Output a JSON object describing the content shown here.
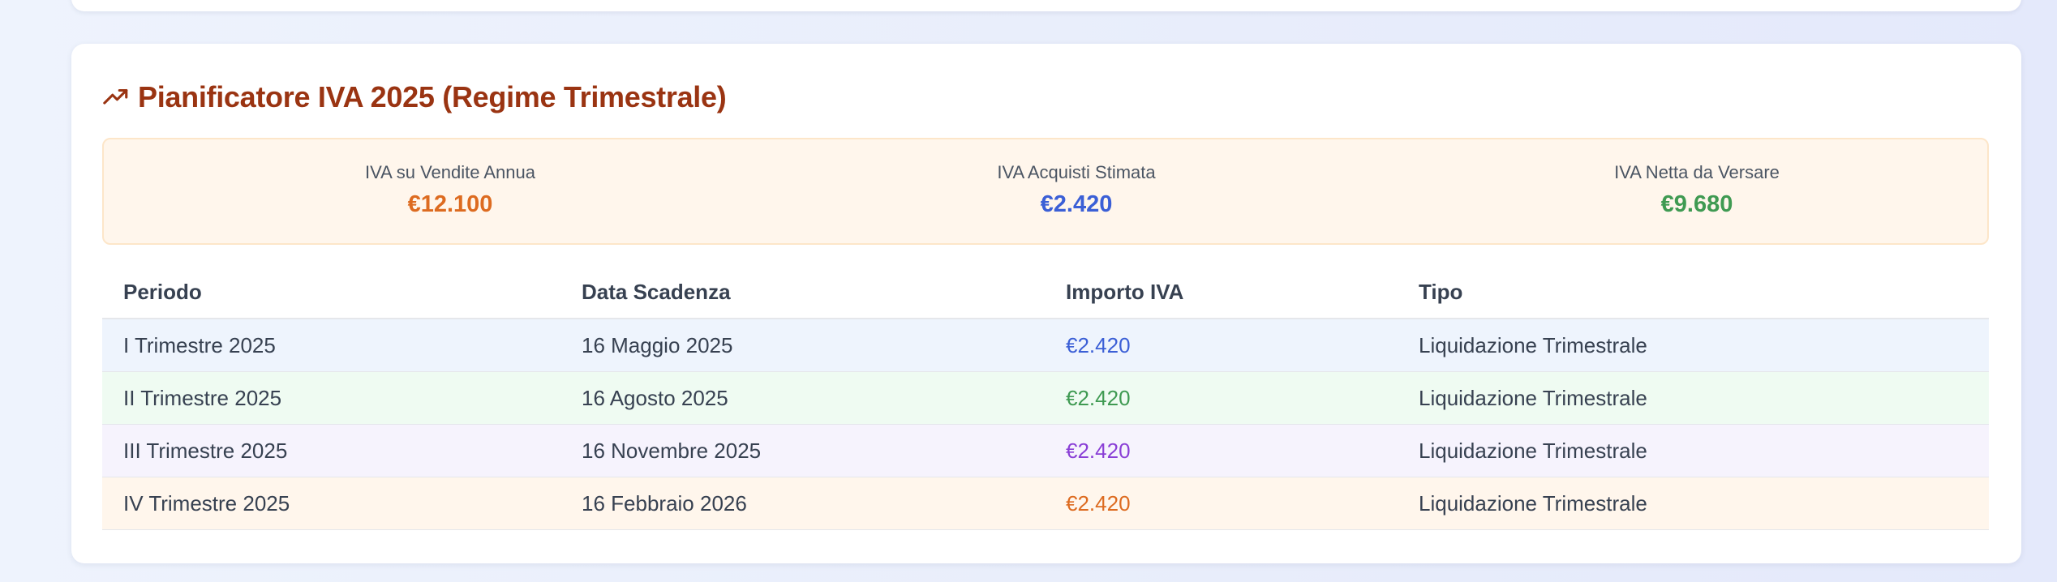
{
  "planner": {
    "title": "Pianificatore IVA 2025 (Regime Trimestrale)",
    "icon": "trending-up-icon",
    "title_color": "#9a3412",
    "summary": [
      {
        "label": "IVA su Vendite Annua",
        "value": "€12.100",
        "color": "#dd6b20"
      },
      {
        "label": "IVA Acquisti Stimata",
        "value": "€2.420",
        "color": "#3b5fd6"
      },
      {
        "label": "IVA Netta da Versare",
        "value": "€9.680",
        "color": "#3f9a52"
      }
    ],
    "table": {
      "headers": [
        "Periodo",
        "Data Scadenza",
        "Importo IVA",
        "Tipo"
      ],
      "rows": [
        {
          "periodo": "I Trimestre 2025",
          "scadenza": "16 Maggio 2025",
          "importo": "€2.420",
          "tipo": "Liquidazione Trimestrale",
          "color": "#3b5fd6"
        },
        {
          "periodo": "II Trimestre 2025",
          "scadenza": "16 Agosto 2025",
          "importo": "€2.420",
          "tipo": "Liquidazione Trimestrale",
          "color": "#3f9a52"
        },
        {
          "periodo": "III Trimestre 2025",
          "scadenza": "16 Novembre 2025",
          "importo": "€2.420",
          "tipo": "Liquidazione Trimestrale",
          "color": "#8a3fd6"
        },
        {
          "periodo": "IV Trimestre 2025",
          "scadenza": "16 Febbraio 2026",
          "importo": "€2.420",
          "tipo": "Liquidazione Trimestrale",
          "color": "#dd6b20"
        }
      ]
    }
  }
}
